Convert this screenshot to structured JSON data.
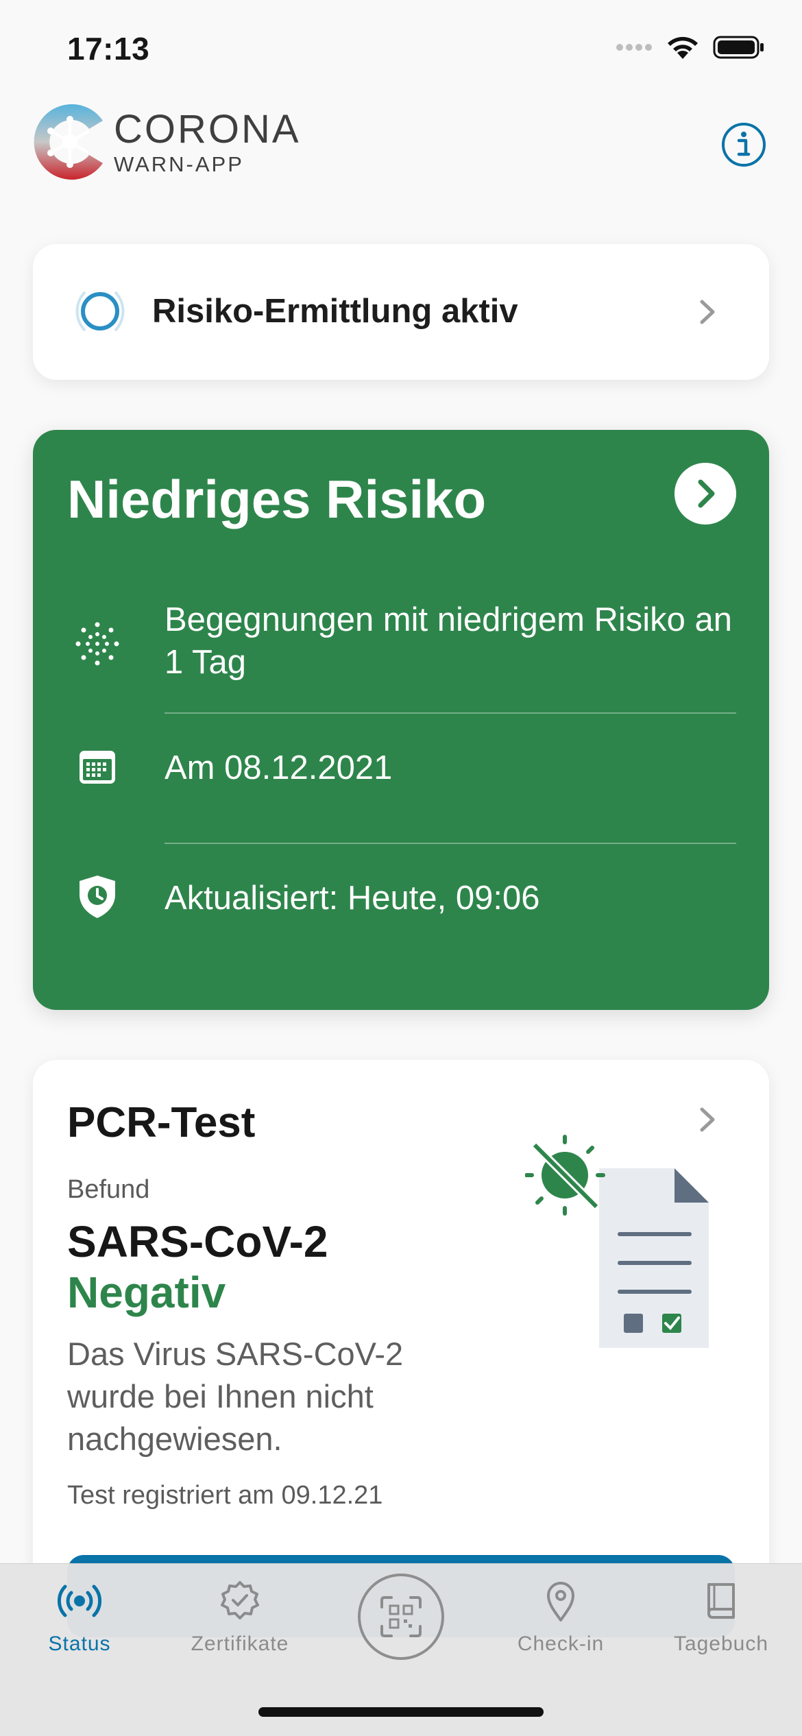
{
  "status_bar": {
    "time": "17:13"
  },
  "header": {
    "logo_line1": "CORONA",
    "logo_line2": "WARN-APP",
    "info_icon": "info-icon"
  },
  "risk_detection": {
    "label": "Risiko-Ermittlung aktiv",
    "icon": "radar-ring-icon"
  },
  "risk_card": {
    "title": "Niedriges Risiko",
    "background": "#2e854b",
    "rows": [
      {
        "icon": "virus-dots-icon",
        "text": "Begegnungen mit niedrigem Risiko an 1 Tag"
      },
      {
        "icon": "calendar-icon",
        "text": "Am 08.12.2021"
      },
      {
        "icon": "shield-clock-icon",
        "text": "Aktualisiert: Heute, 09:06"
      }
    ]
  },
  "test_card": {
    "title": "PCR-Test",
    "befund_label": "Befund",
    "virus": "SARS-CoV-2",
    "result": "Negativ",
    "result_color": "#2e854b",
    "description": "Das Virus SARS-CoV-2 wurde bei Ihnen nicht nachgewiesen.",
    "registered": "Test registriert am 09.12.21"
  },
  "tabbar": {
    "accent": "#0a73a8",
    "tabs": [
      {
        "label": "Status",
        "icon": "broadcast-icon",
        "active": true
      },
      {
        "label": "Zertifikate",
        "icon": "certificate-badge-icon",
        "active": false
      },
      {
        "label": "",
        "icon": "qr-scan-icon",
        "active": false
      },
      {
        "label": "Check-in",
        "icon": "location-pin-icon",
        "active": false
      },
      {
        "label": "Tagebuch",
        "icon": "book-icon",
        "active": false
      }
    ]
  }
}
